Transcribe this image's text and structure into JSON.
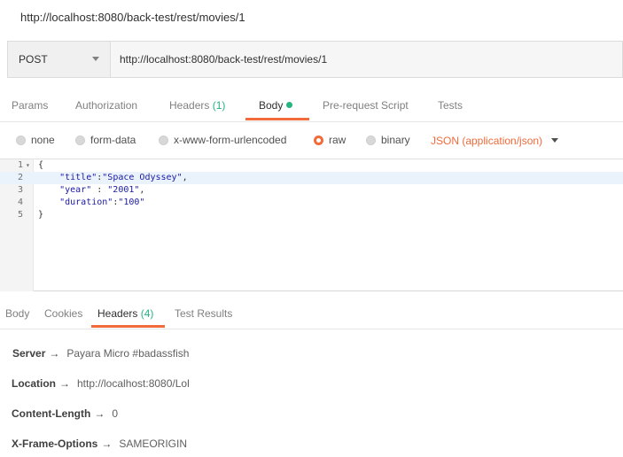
{
  "request_title": "http://localhost:8080/back-test/rest/movies/1",
  "request": {
    "method": "POST",
    "url": "http://localhost:8080/back-test/rest/movies/1"
  },
  "request_tabs": [
    {
      "label": "Params"
    },
    {
      "label": "Authorization"
    },
    {
      "label": "Headers",
      "count": "(1)"
    },
    {
      "label": "Body"
    },
    {
      "label": "Pre-request Script"
    },
    {
      "label": "Tests"
    }
  ],
  "body_types": {
    "options": [
      "none",
      "form-data",
      "x-www-form-urlencoded",
      "raw",
      "binary"
    ],
    "selected": "raw",
    "content_type": "JSON (application/json)"
  },
  "editor": {
    "lines": [
      {
        "num": "1",
        "text": "{"
      },
      {
        "num": "2",
        "key": "\"title\"",
        "sep": ":",
        "value": "\"Space Odyssey\"",
        "end": ","
      },
      {
        "num": "3",
        "key": "\"year\"",
        "sep": " : ",
        "value": "\"2001\"",
        "end": ","
      },
      {
        "num": "4",
        "key": "\"duration\"",
        "sep": ":",
        "value": "\"100\"",
        "end": ""
      },
      {
        "num": "5",
        "text": "}"
      }
    ]
  },
  "response_tabs": [
    {
      "label": "Body"
    },
    {
      "label": "Cookies"
    },
    {
      "label": "Headers",
      "count": "(4)"
    },
    {
      "label": "Test Results"
    }
  ],
  "response_headers": [
    {
      "key": "Server",
      "arrow": "→",
      "value": "Payara Micro #badassfish"
    },
    {
      "key": "Location",
      "arrow": "→",
      "value": "http://localhost:8080/Lol"
    },
    {
      "key": "Content-Length",
      "arrow": "→",
      "value": "0"
    },
    {
      "key": "X-Frame-Options",
      "arrow": "→",
      "value": "SAMEORIGIN"
    }
  ],
  "colors": {
    "accent": "#f26b3a",
    "count_green": "#26b47f",
    "string_blue": "#1a1aa6"
  }
}
